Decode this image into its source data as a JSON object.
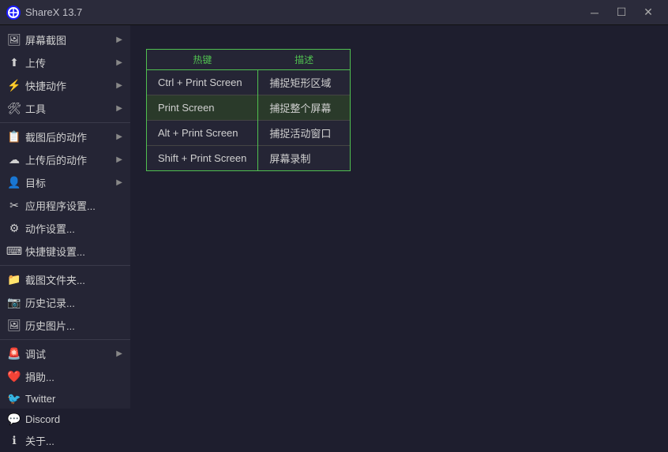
{
  "titlebar": {
    "title": "ShareX 13.7",
    "minimize_label": "─",
    "maximize_label": "☐",
    "close_label": "✕"
  },
  "sidebar": {
    "items": [
      {
        "id": "screenshot",
        "icon": "🖼",
        "label": "屏幕截图",
        "has_arrow": true
      },
      {
        "id": "upload",
        "icon": "⬆",
        "label": "上传",
        "has_arrow": true
      },
      {
        "id": "quickactions",
        "icon": "⚡",
        "label": "快捷动作",
        "has_arrow": true
      },
      {
        "id": "tools",
        "icon": "🛠",
        "label": "工具",
        "has_arrow": true
      },
      {
        "divider": true
      },
      {
        "id": "aftercapture",
        "icon": "📋",
        "label": "截图后的动作",
        "has_arrow": true
      },
      {
        "id": "afterupload",
        "icon": "☁",
        "label": "上传后的动作",
        "has_arrow": true
      },
      {
        "id": "destinations",
        "icon": "👤",
        "label": "目标",
        "has_arrow": true
      },
      {
        "id": "appsettings",
        "icon": "✂",
        "label": "应用程序设置...",
        "has_arrow": false
      },
      {
        "id": "actionsettings",
        "icon": "⚙",
        "label": "动作设置...",
        "has_arrow": false
      },
      {
        "id": "hotkeysettings",
        "icon": "⌨",
        "label": "快捷键设置...",
        "has_arrow": false
      },
      {
        "divider": true
      },
      {
        "id": "capturefolder",
        "icon": "📁",
        "label": "截图文件夹...",
        "has_arrow": false
      },
      {
        "id": "history",
        "icon": "📷",
        "label": "历史记录...",
        "has_arrow": false
      },
      {
        "id": "imagehistory",
        "icon": "🖼",
        "label": "历史图片...",
        "has_arrow": false
      },
      {
        "divider": true
      },
      {
        "id": "debug",
        "icon": "🚨",
        "label": "调试",
        "has_arrow": true
      },
      {
        "id": "donate",
        "icon": "❤",
        "label": "捐助...",
        "has_arrow": false
      },
      {
        "id": "twitter",
        "icon": "🐦",
        "label": "Twitter",
        "has_arrow": false
      },
      {
        "id": "discord",
        "icon": "💬",
        "label": "Discord",
        "has_arrow": false
      },
      {
        "id": "about",
        "icon": "ℹ",
        "label": "关于...",
        "has_arrow": false
      }
    ]
  },
  "hotkey_table": {
    "col_hotkey": "热键",
    "col_description": "描述",
    "rows": [
      {
        "hotkey": "Ctrl + Print Screen",
        "description": "捕捉矩形区域"
      },
      {
        "hotkey": "Print Screen",
        "description": "捕捉整个屏幕"
      },
      {
        "hotkey": "Alt + Print Screen",
        "description": "捕捉活动窗口"
      },
      {
        "hotkey": "Shift + Print Screen",
        "description": "屏幕录制"
      }
    ]
  }
}
